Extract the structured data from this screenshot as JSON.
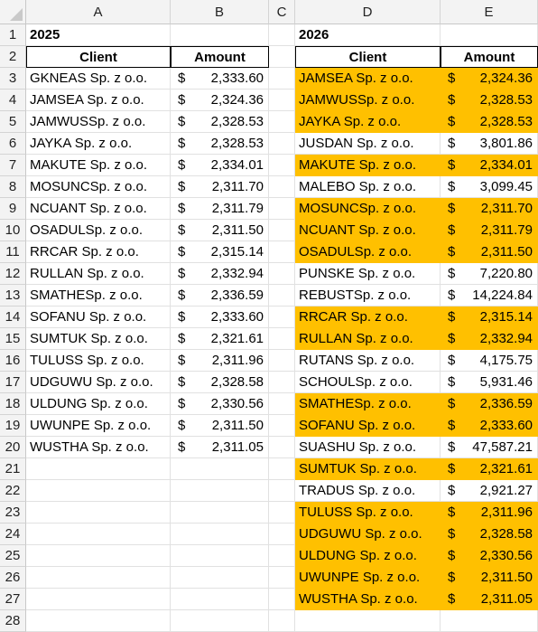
{
  "spreadsheet": {
    "columns": [
      "A",
      "B",
      "C",
      "D",
      "E"
    ],
    "row_count": 28,
    "highlight_color": "#ffc000",
    "table_2025": {
      "title": "2025",
      "headers": {
        "client": "Client",
        "amount": "Amount"
      },
      "currency": "$",
      "rows": [
        {
          "client": "GKNEAS Sp. z o.o.",
          "amount": "2,333.60"
        },
        {
          "client": "JAMSEA Sp. z o.o.",
          "amount": "2,324.36"
        },
        {
          "client": "JAMWUSSp. z o.o.",
          "amount": "2,328.53"
        },
        {
          "client": "JAYKA Sp. z o.o.",
          "amount": "2,328.53"
        },
        {
          "client": "MAKUTE Sp. z o.o.",
          "amount": "2,334.01"
        },
        {
          "client": "MOSUNCSp. z o.o.",
          "amount": "2,311.70"
        },
        {
          "client": "NCUANT Sp. z o.o.",
          "amount": "2,311.79"
        },
        {
          "client": "OSADULSp. z o.o.",
          "amount": "2,311.50"
        },
        {
          "client": "RRCAR Sp. z o.o.",
          "amount": "2,315.14"
        },
        {
          "client": "RULLAN Sp. z o.o.",
          "amount": "2,332.94"
        },
        {
          "client": "SMATHESp. z o.o.",
          "amount": "2,336.59"
        },
        {
          "client": "SOFANU Sp. z o.o.",
          "amount": "2,333.60"
        },
        {
          "client": "SUMTUK Sp. z o.o.",
          "amount": "2,321.61"
        },
        {
          "client": "TULUSS Sp. z o.o.",
          "amount": "2,311.96"
        },
        {
          "client": "UDGUWU Sp. z o.o.",
          "amount": "2,328.58"
        },
        {
          "client": "ULDUNG Sp. z o.o.",
          "amount": "2,330.56"
        },
        {
          "client": "UWUNPE Sp. z o.o.",
          "amount": "2,311.50"
        },
        {
          "client": "WUSTHA Sp. z o.o.",
          "amount": "2,311.05"
        }
      ]
    },
    "table_2026": {
      "title": "2026",
      "headers": {
        "client": "Client",
        "amount": "Amount"
      },
      "currency": "$",
      "rows": [
        {
          "client": "JAMSEA Sp. z o.o.",
          "amount": "2,324.36",
          "highlighted": true
        },
        {
          "client": "JAMWUSSp. z o.o.",
          "amount": "2,328.53",
          "highlighted": true
        },
        {
          "client": "JAYKA Sp. z o.o.",
          "amount": "2,328.53",
          "highlighted": true
        },
        {
          "client": "JUSDAN Sp.  z o.o.",
          "amount": "3,801.86",
          "highlighted": false
        },
        {
          "client": "MAKUTE Sp. z o.o.",
          "amount": "2,334.01",
          "highlighted": true
        },
        {
          "client": "MALEBO Sp. z o.o.",
          "amount": "3,099.45",
          "highlighted": false
        },
        {
          "client": "MOSUNCSp. z o.o.",
          "amount": "2,311.70",
          "highlighted": true
        },
        {
          "client": "NCUANT Sp. z o.o.",
          "amount": "2,311.79",
          "highlighted": true
        },
        {
          "client": "OSADULSp. z o.o.",
          "amount": "2,311.50",
          "highlighted": true
        },
        {
          "client": "PUNSKE Sp. z o.o.",
          "amount": "7,220.80",
          "highlighted": false
        },
        {
          "client": "REBUSTSp. z o.o.",
          "amount": "14,224.84",
          "highlighted": false
        },
        {
          "client": "RRCAR Sp. z o.o.",
          "amount": "2,315.14",
          "highlighted": true
        },
        {
          "client": "RULLAN Sp. z o.o.",
          "amount": "2,332.94",
          "highlighted": true
        },
        {
          "client": "RUTANS Sp. z o.o.",
          "amount": "4,175.75",
          "highlighted": false
        },
        {
          "client": "SCHOULSp. z o.o.",
          "amount": "5,931.46",
          "highlighted": false
        },
        {
          "client": "SMATHESp. z o.o.",
          "amount": "2,336.59",
          "highlighted": true
        },
        {
          "client": "SOFANU Sp. z o.o.",
          "amount": "2,333.60",
          "highlighted": true
        },
        {
          "client": "SUASHU Sp. z o.o.",
          "amount": "47,587.21",
          "highlighted": false
        },
        {
          "client": "SUMTUK Sp. z o.o.",
          "amount": "2,321.61",
          "highlighted": true
        },
        {
          "client": "TRADUS Sp. z o.o.",
          "amount": "2,921.27",
          "highlighted": false
        },
        {
          "client": "TULUSS Sp. z o.o.",
          "amount": "2,311.96",
          "highlighted": true
        },
        {
          "client": "UDGUWU Sp. z o.o.",
          "amount": "2,328.58",
          "highlighted": true
        },
        {
          "client": "ULDUNG Sp. z o.o.",
          "amount": "2,330.56",
          "highlighted": true
        },
        {
          "client": "UWUNPE Sp. z o.o.",
          "amount": "2,311.50",
          "highlighted": true
        },
        {
          "client": "WUSTHA Sp. z o.o.",
          "amount": "2,311.05",
          "highlighted": true
        }
      ]
    }
  }
}
